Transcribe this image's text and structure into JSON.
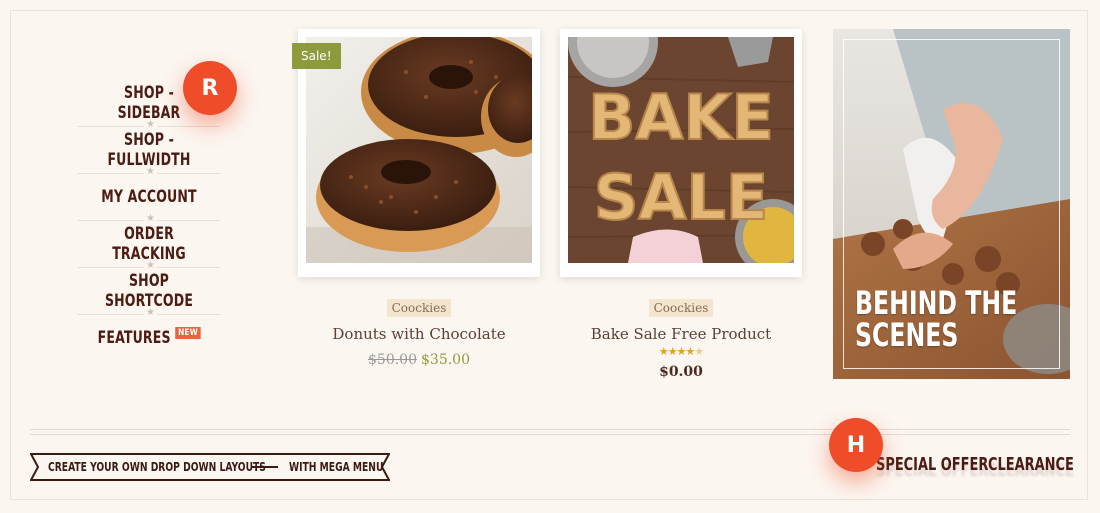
{
  "menu": {
    "items": [
      {
        "label": "Shop - Sidebar"
      },
      {
        "label": "Shop - Fullwidth"
      },
      {
        "label": "My Account"
      },
      {
        "label": "Order Tracking"
      },
      {
        "label": "Shop Shortcode"
      },
      {
        "label": "Features",
        "badge": "NEW"
      }
    ]
  },
  "floating": {
    "r_label": "R",
    "h_label": "H",
    "color": "#ef4d2a"
  },
  "products": [
    {
      "sale_badge": "Sale!",
      "category": "Coockies",
      "name": "Donuts with Chocolate",
      "old_price": "$50.00",
      "price": "$35.00"
    },
    {
      "category": "Coockies",
      "name": "Bake Sale Free Product",
      "rating": 4.5,
      "price": "$0.00",
      "image_text_1": "BAKE",
      "image_text_2": "SALE"
    }
  ],
  "promo": {
    "title_line1": "Behind the",
    "title_line2": "Scenes"
  },
  "footer": {
    "ribbon_left": "Create your own drop down layouts",
    "ribbon_right": "With mega menu",
    "links": [
      "Special Offer",
      "Clearance"
    ]
  },
  "colors": {
    "accent": "#ef4d2a",
    "sale_green": "#8e9b3c",
    "text_brown": "#4b1c14",
    "background": "#fbf6f0"
  }
}
